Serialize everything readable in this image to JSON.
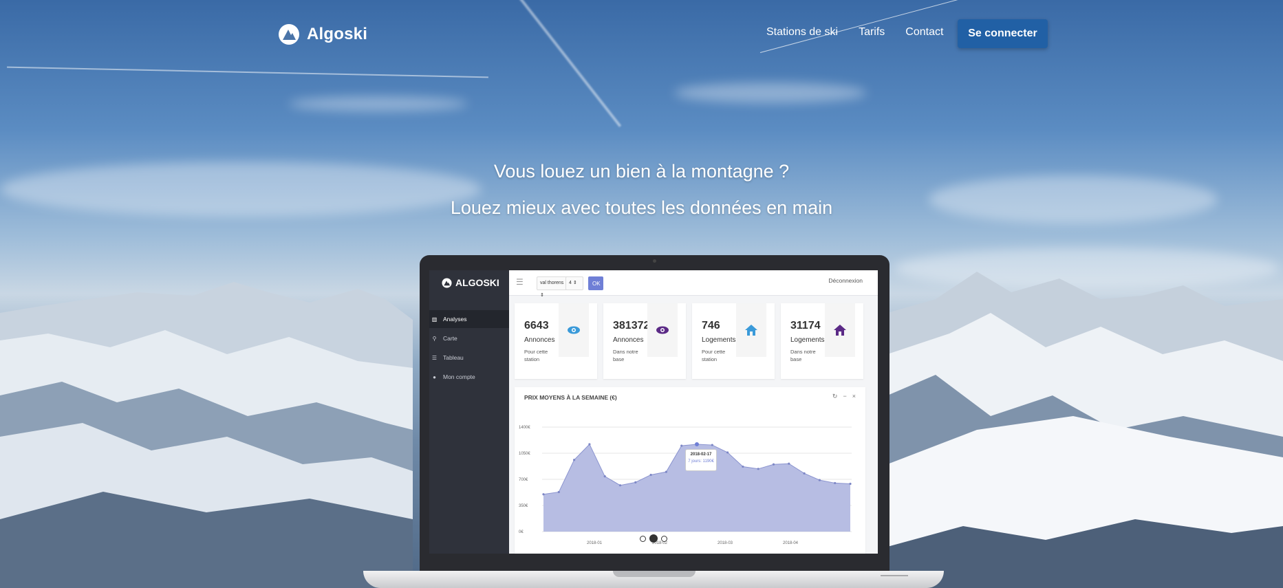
{
  "brand": {
    "name": "Algoski"
  },
  "nav": {
    "links": [
      "Stations de ski",
      "Tarifs",
      "Contact"
    ],
    "login_label": "Se connecter"
  },
  "hero": {
    "line1": "Vous louez un bien à la montagne ?",
    "line2": "Louez mieux avec toutes les données en main"
  },
  "dashboard": {
    "brand": "ALGOSKI",
    "sidebar": [
      {
        "label": "Analyses",
        "icon": "bar-chart-icon",
        "active": true
      },
      {
        "label": "Carte",
        "icon": "map-pin-icon",
        "active": false
      },
      {
        "label": "Tableau",
        "icon": "list-icon",
        "active": false
      },
      {
        "label": "Mon compte",
        "icon": "user-icon",
        "active": false
      }
    ],
    "station_select": "val thorens ⇕",
    "people_select": "4 ⇕",
    "ok_label": "OK",
    "logout_label": "Déconnexion",
    "cards": [
      {
        "value": "6643",
        "label": "Annonces",
        "sub": "Pour cette station",
        "icon": "eye-icon",
        "color": "#3a9ad9"
      },
      {
        "value": "381372",
        "label": "Annonces",
        "sub": "Dans notre base",
        "icon": "eye-icon",
        "color": "#5b2a86"
      },
      {
        "value": "746",
        "label": "Logements",
        "sub": "Pour cette station",
        "icon": "house-icon",
        "color": "#3a9ad9"
      },
      {
        "value": "31174",
        "label": "Logements",
        "sub": "Dans notre base",
        "icon": "house-icon",
        "color": "#5b2a86"
      }
    ],
    "chart_title": "PRIX MOYENS À LA SEMAINE (€)",
    "tooltip": {
      "date": "2018-02-17",
      "text": "7 jours: 1190€"
    }
  },
  "chart_data": {
    "type": "area",
    "title": "PRIX MOYENS À LA SEMAINE (€)",
    "yticks": [
      "1400€",
      "1050€",
      "700€",
      "350€",
      "0€"
    ],
    "xticks": [
      "2018-01",
      "2018-02",
      "2018-03",
      "2018-04"
    ],
    "ylim": [
      0,
      1400
    ],
    "values": [
      500,
      530,
      960,
      1170,
      740,
      620,
      660,
      760,
      800,
      1150,
      1170,
      1160,
      1060,
      870,
      840,
      900,
      910,
      780,
      690,
      650,
      640
    ],
    "color": "#b7bde3",
    "line_color": "#8a93cf"
  },
  "carousel": {
    "count": 3,
    "active": 1
  },
  "colors": {
    "primary_button": "#2160a5",
    "accent": "#6f7fd6"
  }
}
